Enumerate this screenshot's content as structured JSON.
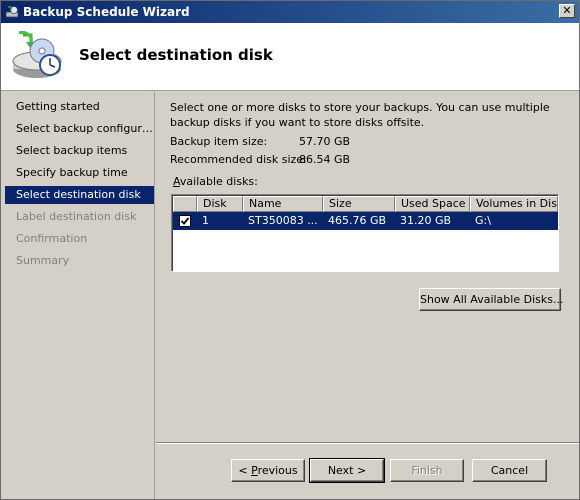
{
  "window": {
    "title": "Backup Schedule Wizard",
    "close_symbol": "✕"
  },
  "header": {
    "title": "Select destination disk",
    "icon": "backup-schedule-icon"
  },
  "nav": {
    "items": [
      {
        "label": "Getting started",
        "state": "normal"
      },
      {
        "label": "Select backup configur…",
        "state": "normal"
      },
      {
        "label": "Select backup items",
        "state": "normal"
      },
      {
        "label": "Specify backup time",
        "state": "normal"
      },
      {
        "label": "Select destination disk",
        "state": "selected"
      },
      {
        "label": "Label destination disk",
        "state": "disabled"
      },
      {
        "label": "Confirmation",
        "state": "disabled"
      },
      {
        "label": "Summary",
        "state": "disabled"
      }
    ]
  },
  "content": {
    "description": "Select one or more disks to store your backups. You can use multiple backup disks if you want to store disks offsite.",
    "backup_item_size_label": "Backup item size:",
    "backup_item_size_value": "57.70 GB",
    "recommended_size_label": "Recommended disk size:",
    "recommended_size_value": "86.54 GB",
    "available_disks_label_first": "A",
    "available_disks_label_rest": "vailable disks:"
  },
  "disk_table": {
    "columns": [
      "Disk",
      "Name",
      "Size",
      "Used Space",
      "Volumes in Disk"
    ],
    "rows": [
      {
        "checked": true,
        "disk": "1",
        "name": "ST350083 ...",
        "size": "465.76 GB",
        "used_space": "31.20 GB",
        "volumes": "G:\\"
      }
    ]
  },
  "buttons": {
    "show_all": "Show All Available Disks...",
    "previous_prefix": "< ",
    "previous_underlined": "P",
    "previous_rest": "revious",
    "next": "Next >",
    "finish": "Finish",
    "cancel": "Cancel"
  }
}
